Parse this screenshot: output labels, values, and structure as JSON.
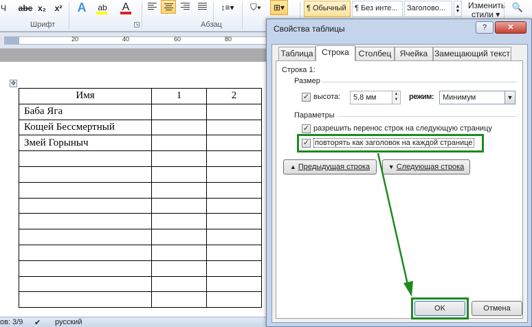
{
  "ribbon": {
    "format_buttons": [
      "abc",
      "x₂",
      "x²"
    ],
    "font_group_label": "Шрифт",
    "paragraph_group_label": "Абзац",
    "styles": [
      "¶ Обычный",
      "¶ Без инте...",
      "Заголово..."
    ],
    "change_styles_label_1": "Изменить",
    "change_styles_label_2": "стили ▾"
  },
  "ruler": {
    "numbers": [
      "20",
      "40",
      "60",
      "80"
    ]
  },
  "document": {
    "table": [
      [
        "Имя",
        "1",
        "2"
      ],
      [
        "Баба Яга",
        "",
        ""
      ],
      [
        "Кощей Бессмертный",
        "",
        ""
      ],
      [
        "Змей Горыныч",
        "",
        ""
      ],
      [
        "",
        "",
        ""
      ],
      [
        "",
        "",
        ""
      ],
      [
        "",
        "",
        ""
      ],
      [
        "",
        "",
        ""
      ],
      [
        "",
        "",
        ""
      ],
      [
        "",
        "",
        ""
      ],
      [
        "",
        "",
        ""
      ],
      [
        "",
        "",
        ""
      ],
      [
        "",
        "",
        ""
      ],
      [
        "",
        "",
        ""
      ]
    ]
  },
  "status_bar": {
    "pages": "ов: 3/9",
    "language": "русский"
  },
  "dialog": {
    "title": "Свойства таблицы",
    "help_btn": "?",
    "close_btn": "✕",
    "tabs": [
      "Таблица",
      "Строка",
      "Столбец",
      "Ячейка",
      "Замещающий текст"
    ],
    "active_tab": "Строка",
    "row_label": "Строка 1:",
    "size_section": "Размер",
    "height_checkbox_label": "высота:",
    "height_value": "5,8 мм",
    "mode_label": "режим:",
    "mode_value": "Минимум",
    "params_section": "Параметры",
    "allow_break_label": "разрешить перенос строк на следующую страницу",
    "repeat_header_label": "повторять как заголовок на каждой странице",
    "prev_row_btn": "Предыдущая строка",
    "next_row_btn": "Следующая строка",
    "ok_btn": "OK",
    "cancel_btn": "Отмена",
    "checkbox_mark": "✓"
  },
  "colors": {
    "highlight_green": "#1d8a1d",
    "ribbon_active": "#ffd16a"
  }
}
